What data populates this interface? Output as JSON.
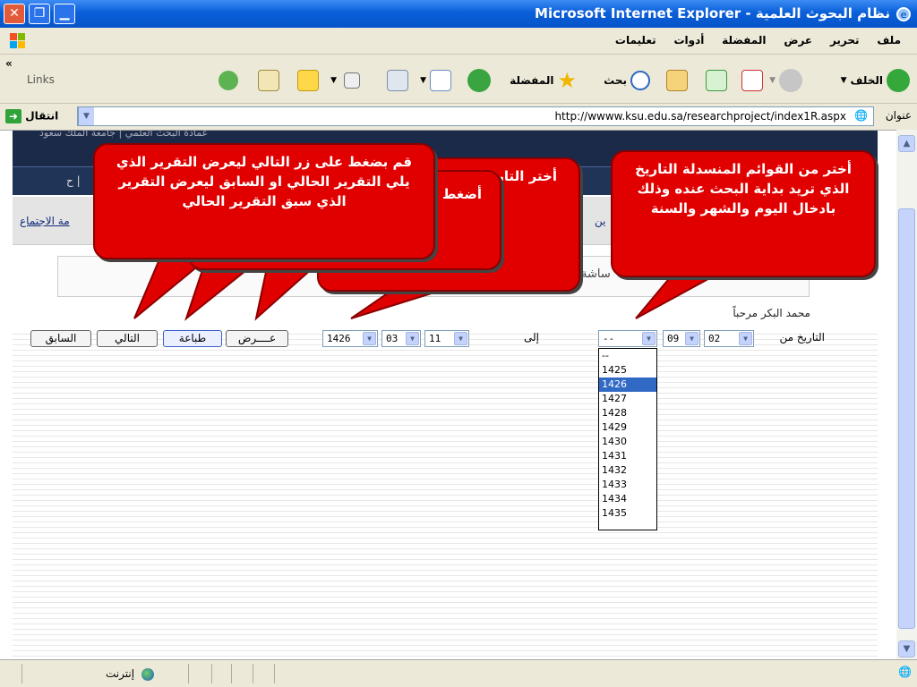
{
  "window": {
    "title": "نظام البحوث العلمية - Microsoft Internet Explorer"
  },
  "menu": [
    "ملف",
    "تحرير",
    "عرض",
    "المفضلة",
    "أدوات",
    "تعليمات"
  ],
  "toolbar": {
    "back_label": "الخلف",
    "search_label": "بحث",
    "favorites_label": "المفضلة",
    "links_label": "Links"
  },
  "address": {
    "label": "عنوان",
    "url": "http://wwww.ksu.edu.sa/researchproject/index1R.aspx",
    "go_label": "انتقال"
  },
  "page": {
    "banner_text": "عمادة البحث العلمي | جامعة الملك سعود",
    "link_left": "مة الاجتماع",
    "link_mid": "ين",
    "mid_text": "ساشة",
    "greeting": "محمد البكر مرحباً",
    "from_label": "التاريخ من",
    "to_label": "إلى",
    "from_day": "02",
    "from_month": "09",
    "from_year": "--",
    "to_day": "11",
    "to_month": "03",
    "to_year": "1426",
    "view_button": "عــــرض",
    "print_button": "طباعة",
    "next_button": "التالي",
    "prev_button": "السابق",
    "year_options": [
      "--",
      "1425",
      "1426",
      "1427",
      "1428",
      "1429",
      "1430",
      "1431",
      "1432",
      "1433",
      "1434",
      "1435"
    ],
    "year_selected": "1426"
  },
  "callouts": {
    "right": "أختر من القوائم المنسدلة التاريخ الذي  تريد بداية البحث عنده وذلك بادخال اليوم والشهر والسنة",
    "middle": "أختر التاريخ عنده وذ",
    "back": "أضغط لك جم",
    "left": "قم بضغط على زر التالي ليعرض التقرير الذي يلي التقرير الحالي او السابق ليعرض التقرير الذي سبق التقرير الحالي"
  },
  "status": {
    "zone": "إنترنت"
  }
}
